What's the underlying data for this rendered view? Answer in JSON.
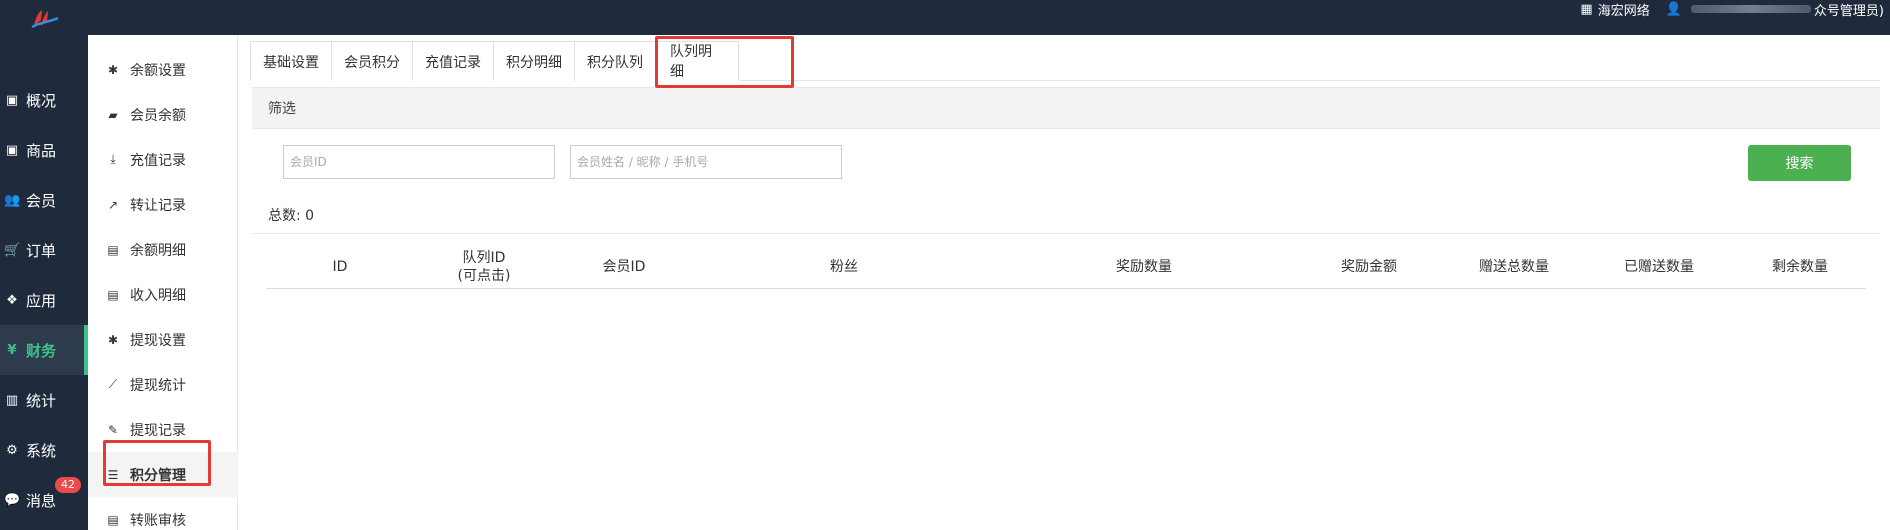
{
  "topbar": {
    "company": "海宏网络",
    "user_suffix": "众号管理员)"
  },
  "sidebar": {
    "items": [
      {
        "label": "概况",
        "icon": "dashboard-icon"
      },
      {
        "label": "商品",
        "icon": "box-icon"
      },
      {
        "label": "会员",
        "icon": "users-icon"
      },
      {
        "label": "订单",
        "icon": "cart-icon"
      },
      {
        "label": "应用",
        "icon": "cubes-icon"
      },
      {
        "label": "财务",
        "icon": "yen-icon"
      },
      {
        "label": "统计",
        "icon": "bar-chart-icon"
      },
      {
        "label": "系统",
        "icon": "gears-icon"
      },
      {
        "label": "消息",
        "icon": "comment-icon"
      }
    ],
    "message_badge": "42",
    "active_color": "#3cc18b"
  },
  "submenu": {
    "items": [
      {
        "label": "余额设置",
        "icon": "gear-icon"
      },
      {
        "label": "会员余额",
        "icon": "book-icon"
      },
      {
        "label": "充值记录",
        "icon": "download-icon"
      },
      {
        "label": "转让记录",
        "icon": "external-link-icon"
      },
      {
        "label": "余额明细",
        "icon": "file-icon"
      },
      {
        "label": "收入明细",
        "icon": "file-icon"
      },
      {
        "label": "提现设置",
        "icon": "gear-icon"
      },
      {
        "label": "提现统计",
        "icon": "line-chart-icon"
      },
      {
        "label": "提现记录",
        "icon": "pencil-icon"
      },
      {
        "label": "积分管理",
        "icon": "database-icon"
      },
      {
        "label": "转账审核",
        "icon": "file-icon"
      }
    ]
  },
  "tabs": [
    {
      "label": "基础设置"
    },
    {
      "label": "会员积分"
    },
    {
      "label": "充值记录"
    },
    {
      "label": "积分明细"
    },
    {
      "label": "积分队列"
    },
    {
      "label": "队列明细"
    }
  ],
  "filter": {
    "title": "筛选",
    "member_id_placeholder": "会员ID",
    "member_name_placeholder": "会员姓名 / 昵称 / 手机号",
    "search_label": "搜索",
    "search_color": "#4caf50"
  },
  "summary": {
    "total_label": "总数:",
    "total_value": "0"
  },
  "table": {
    "headers": [
      {
        "line1": "ID",
        "line2": ""
      },
      {
        "line1": "队列ID",
        "line2": "(可点击)"
      },
      {
        "line1": "会员ID",
        "line2": ""
      },
      {
        "line1": "粉丝",
        "line2": ""
      },
      {
        "line1": "奖励数量",
        "line2": ""
      },
      {
        "line1": "奖励金额",
        "line2": ""
      },
      {
        "line1": "赠送总数量",
        "line2": ""
      },
      {
        "line1": "已赠送数量",
        "line2": ""
      },
      {
        "line1": "剩余数量",
        "line2": ""
      }
    ]
  },
  "highlight_color": "#e53935"
}
